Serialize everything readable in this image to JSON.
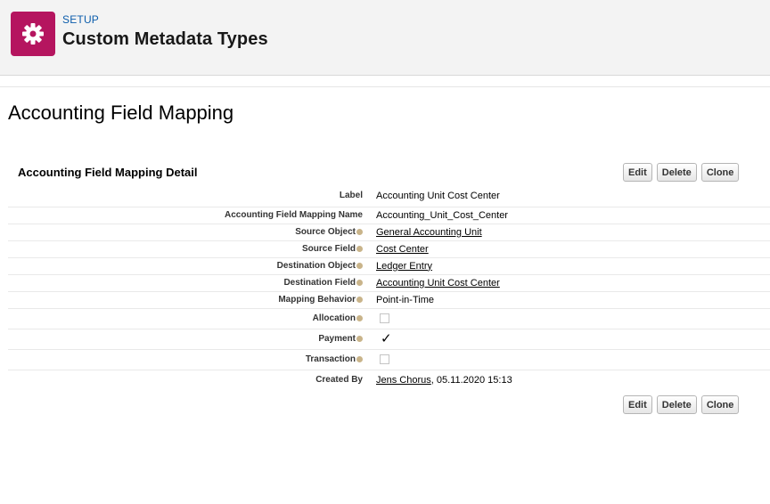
{
  "header": {
    "eyebrow": "SETUP",
    "title": "Custom Metadata Types",
    "icon": "gear-icon",
    "icon_color": "#b5155f"
  },
  "page": {
    "title": "Accounting Field Mapping"
  },
  "detail": {
    "section_title": "Accounting Field Mapping Detail",
    "buttons": {
      "edit": "Edit",
      "delete": "Delete",
      "clone": "Clone"
    },
    "fields": [
      {
        "label": "Label",
        "value": "Accounting Unit Cost Center"
      },
      {
        "label": "Accounting Field Mapping Name",
        "value": "Accounting_Unit_Cost_Center"
      },
      {
        "label": "Source Object",
        "value": "General Accounting Unit"
      },
      {
        "label": "Source Field",
        "value": "Cost Center"
      },
      {
        "label": "Destination Object",
        "value": "Ledger Entry"
      },
      {
        "label": "Destination Field",
        "value": "Accounting Unit Cost Center"
      },
      {
        "label": "Mapping Behavior",
        "value": "Point-in-Time"
      },
      {
        "label": "Allocation",
        "checked": false
      },
      {
        "label": "Payment",
        "checked": true,
        "mark": "✓"
      },
      {
        "label": "Transaction",
        "checked": false
      },
      {
        "label": "Created By",
        "user": "Jens Chorus",
        "date": ", 05.11.2020 15:13"
      }
    ]
  }
}
